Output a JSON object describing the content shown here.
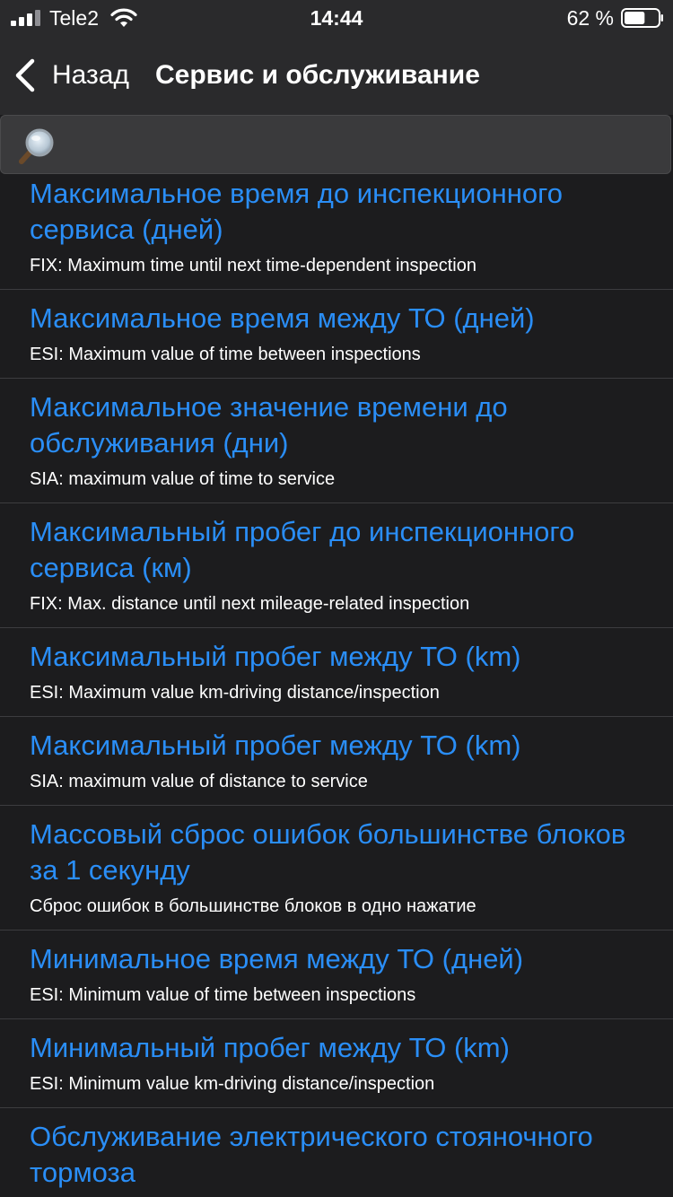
{
  "status_bar": {
    "carrier": "Tele2",
    "time": "14:44",
    "battery_percent": "62 %",
    "battery_level": 0.62,
    "icons": [
      "signal-icon",
      "wifi-icon",
      "battery-icon"
    ]
  },
  "nav": {
    "back_label": "Назад",
    "title": "Сервис и обслуживание",
    "back_icon": "chevron-left-icon"
  },
  "search": {
    "placeholder": "",
    "value": "",
    "icon": "search-icon"
  },
  "colors": {
    "background": "#1c1c1e",
    "bar": "#2a2a2c",
    "accent": "#2a8ef7",
    "separator": "#3c3c3f"
  },
  "items": [
    {
      "title": "Максимальное время до инспекционного сервиса (дней)",
      "subtitle": "FIX: Maximum time until next time-dependent inspection"
    },
    {
      "title": "Максимальное время между ТО (дней)",
      "subtitle": "ESI: Maximum value of time between inspections"
    },
    {
      "title": "Максимальное значение времени до обслуживания (дни)",
      "subtitle": "SIA: maximum value of time to service"
    },
    {
      "title": "Максимальный пробег до инспекционного сервиса (км)",
      "subtitle": "FIX: Max. distance until next mileage-related inspection"
    },
    {
      "title": "Максимальный пробег между ТО (km)",
      "subtitle": "ESI: Maximum value km-driving distance/inspection"
    },
    {
      "title": "Максимальный пробег между ТО (km)",
      "subtitle": "SIA: maximum value of distance to service"
    },
    {
      "title": "Массовый сброс ошибок большинстве блоков за 1 секунду",
      "subtitle": "Сброс ошибок в большинстве блоков в одно нажатие"
    },
    {
      "title": "Минимальное время между ТО (дней)",
      "subtitle": "ESI: Minimum value of time between inspections"
    },
    {
      "title": "Минимальный пробег между ТО (km)",
      "subtitle": "ESI: Minimum value km-driving distance/inspection"
    },
    {
      "title": "Обслуживание электрического стояночного тормоза",
      "subtitle": ""
    }
  ]
}
